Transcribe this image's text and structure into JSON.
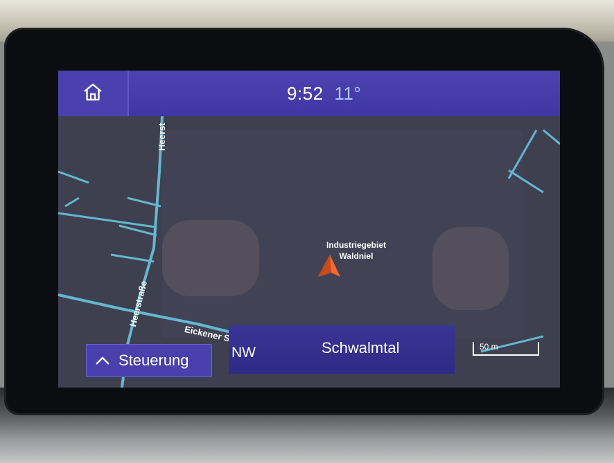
{
  "topbar": {
    "time": "9:52",
    "temperature": "11°"
  },
  "map": {
    "poi_label_line1": "Industriegebiet",
    "poi_label_line2": "Waldniel",
    "streets": {
      "heerstrasse_top": "Heerst",
      "heerstrasse_left": "Heerstraße",
      "eickener": "Eickener Straße"
    },
    "scale_label": "50 m"
  },
  "controls": {
    "steering_label": "Steuerung"
  },
  "status": {
    "heading": "NW",
    "current_road": "Schwalmtal"
  },
  "colors": {
    "topbar": "#4d43b2",
    "map_background": "#3f4150",
    "roads": "#63b8cf",
    "vehicle_arrow": "#f26a2e"
  },
  "icons": {
    "home": "home-icon",
    "vehicle": "vehicle-position-icon",
    "steering_chevron": "chevron-up-icon"
  }
}
